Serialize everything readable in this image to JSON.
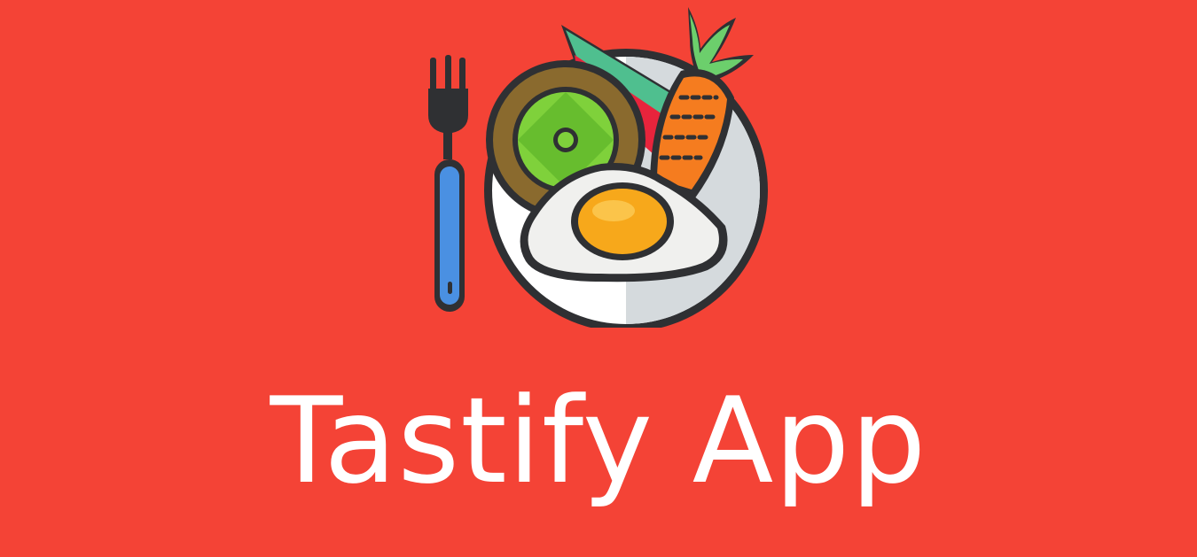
{
  "app": {
    "title": "Tastify App"
  },
  "logo": {
    "icon": "food-plate-with-fork-icon"
  },
  "colors": {
    "background": "#f44336",
    "title_text": "#ffffff",
    "outline": "#2f3033",
    "fork_handle": "#4a90e2",
    "carrot": "#f57c1f",
    "carrot_leaves": "#6ccf6c",
    "egg_white": "#f0f0ee",
    "yolk": "#f7a81b",
    "kiwi_outer": "#8a6a2e",
    "kiwi_inner": "#7fd13b",
    "watermelon_rind": "#4fbf8f",
    "watermelon_flesh": "#e8243c",
    "plate": "#ffffff",
    "plate_shadow": "#d5dadd"
  }
}
